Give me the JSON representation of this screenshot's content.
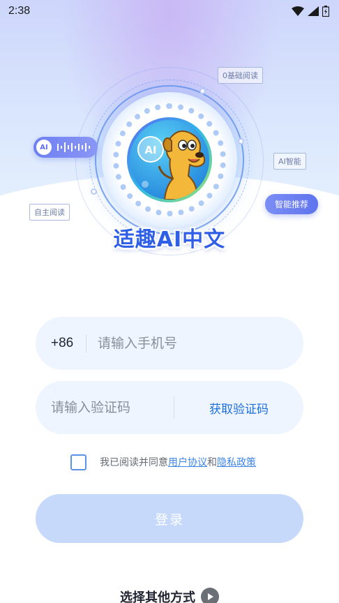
{
  "status_bar": {
    "time": "2:38"
  },
  "hero": {
    "logo_text": "适趣AI中文",
    "tags": {
      "zero_base_reading": "0基础阅读",
      "ai_smart": "AI智能",
      "smart_recommend": "智能推荐",
      "self_reading": "自主阅读",
      "ai_badge": "AI"
    },
    "avatar_badge": "AI"
  },
  "form": {
    "phone_prefix": "+86",
    "phone_placeholder": "请输入手机号",
    "code_placeholder": "请输入验证码",
    "get_code_label": "获取验证码"
  },
  "agreement": {
    "prefix": "我已阅读并同意",
    "user_agreement": "用户协议",
    "and": "和",
    "privacy_policy": "隐私政策"
  },
  "login_label": "登录",
  "other_methods_label": "选择其他方式",
  "colors": {
    "accent": "#1d6fe0",
    "button_disabled": "#c6d9fb",
    "field_bg": "#eef5ff",
    "link": "#3d86e8"
  }
}
